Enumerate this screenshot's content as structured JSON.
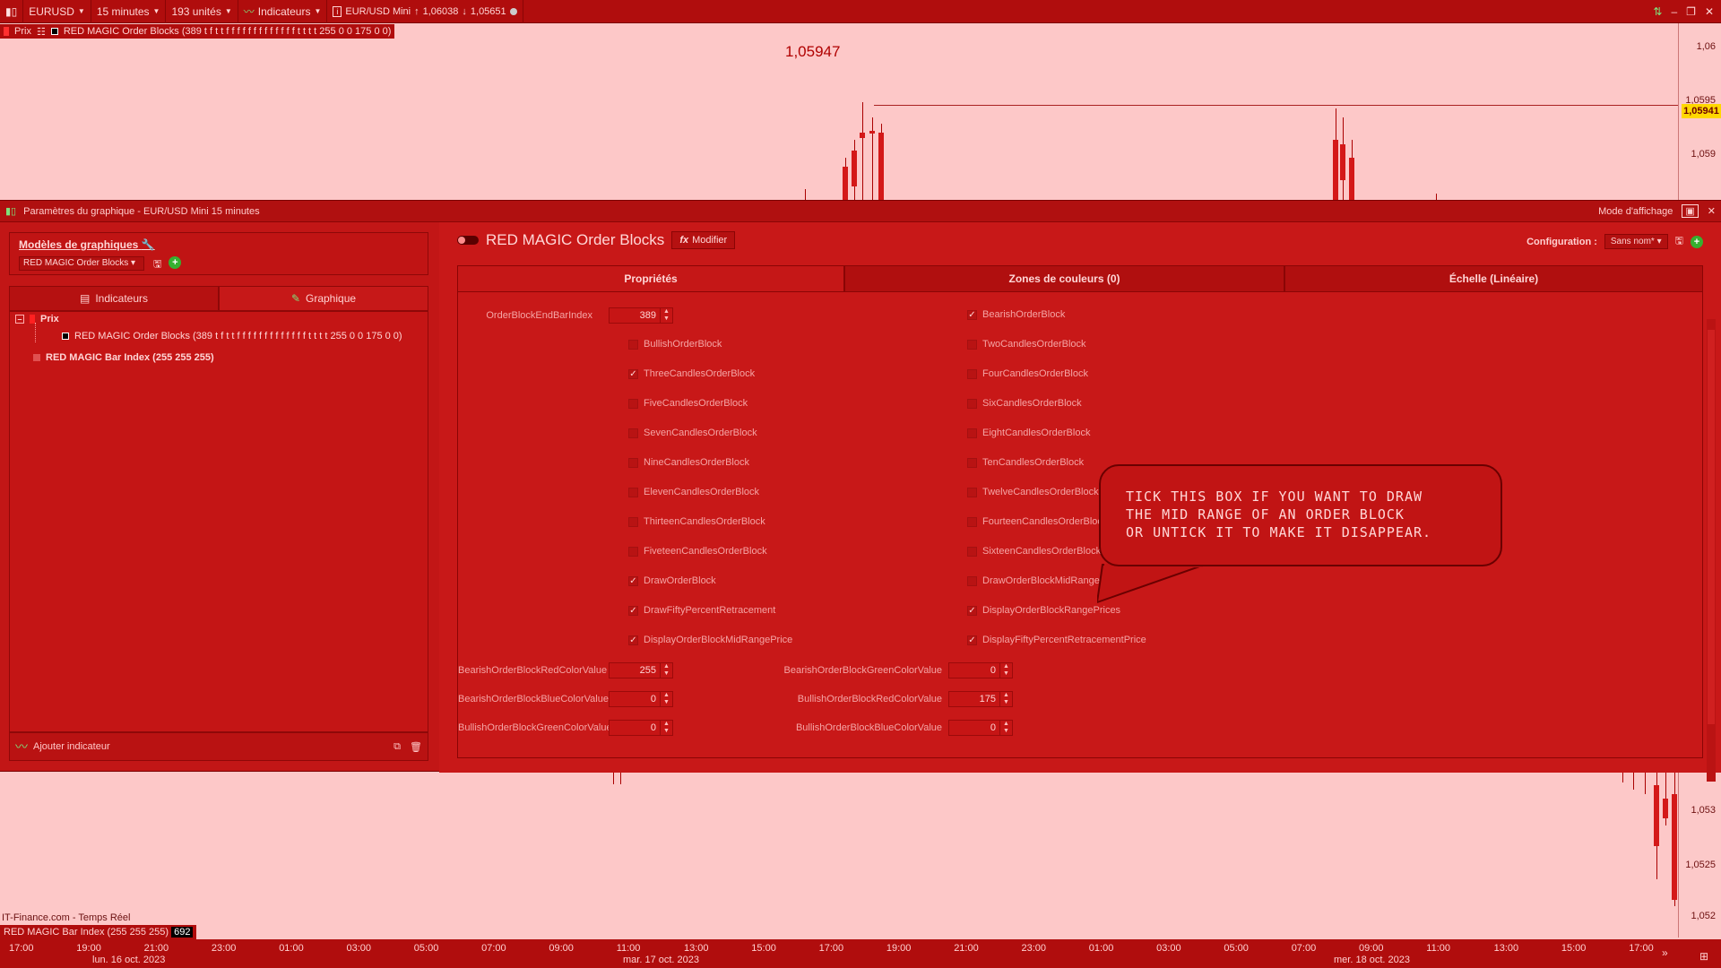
{
  "toolbar": {
    "symbol": "EURUSD",
    "timeframe": "15 minutes",
    "units": "193 unités",
    "indicators": "Indicateurs",
    "instrument": "EUR/USD Mini",
    "up_price": "1,06038",
    "down_price": "1,05651"
  },
  "chart": {
    "legend_prefix": "Prix",
    "legend_text": "RED MAGIC Order Blocks (389 t f t t f f f f f f f f f f f f f t t t t 255 0 0 175 0 0)",
    "price_label": "1,05947",
    "y_ticks": [
      "1,06",
      "1,0595",
      "1,059",
      "1,053",
      "1,0525",
      "1,052"
    ],
    "current_price_tag": "1,05941",
    "source_text": "IT-Finance.com - Temps Réel",
    "bottom_legend_text": "RED MAGIC Bar Index (255 255 255)",
    "bottom_legend_value": "692",
    "x_ticks": [
      "17:00",
      "19:00",
      "21:00",
      "23:00",
      "01:00",
      "03:00",
      "05:00",
      "07:00",
      "09:00",
      "11:00",
      "13:00",
      "15:00",
      "17:00",
      "19:00",
      "21:00",
      "23:00",
      "01:00",
      "03:00",
      "05:00",
      "07:00",
      "09:00",
      "11:00",
      "13:00",
      "15:00",
      "17:00"
    ],
    "x_dates": [
      "lun. 16 oct. 2023",
      "mar. 17 oct. 2023",
      "mer. 18 oct. 2023"
    ]
  },
  "dialog": {
    "title": "Paramètres du graphique - EUR/USD Mini 15 minutes",
    "display_mode": "Mode d'affichage",
    "models_title": "Modèles de graphiques",
    "models_select": "RED MAGIC Order Blocks",
    "tab_indicators": "Indicateurs",
    "tab_chart": "Graphique",
    "tree_price": "Prix",
    "tree_order_blocks": "RED MAGIC Order Blocks (389 t f t t f f f f f f f f f f f f f t t t t 255 0 0 175 0 0)",
    "tree_bar_index": "RED MAGIC Bar Index (255 255 255)",
    "add_indicator": "Ajouter indicateur",
    "indicator_name": "RED MAGIC Order Blocks",
    "modify": "Modifier",
    "config_label": "Configuration :",
    "config_value": "Sans nom*",
    "tabs": [
      "Propriétés",
      "Zones de couleurs (0)",
      "Échelle (Linéaire)"
    ]
  },
  "props": {
    "order_block_end_bar_index": {
      "label": "OrderBlockEndBarIndex",
      "value": "389"
    },
    "left_checks": [
      {
        "label": "BullishOrderBlock",
        "checked": false
      },
      {
        "label": "ThreeCandlesOrderBlock",
        "checked": true
      },
      {
        "label": "FiveCandlesOrderBlock",
        "checked": false
      },
      {
        "label": "SevenCandlesOrderBlock",
        "checked": false
      },
      {
        "label": "NineCandlesOrderBlock",
        "checked": false
      },
      {
        "label": "ElevenCandlesOrderBlock",
        "checked": false
      },
      {
        "label": "ThirteenCandlesOrderBlock",
        "checked": false
      },
      {
        "label": "FiveteenCandlesOrderBlock",
        "checked": false
      },
      {
        "label": "DrawOrderBlock",
        "checked": true
      },
      {
        "label": "DrawFiftyPercentRetracement",
        "checked": true
      },
      {
        "label": "DisplayOrderBlockMidRangePrice",
        "checked": true
      }
    ],
    "right_checks": [
      {
        "label": "BearishOrderBlock",
        "checked": true
      },
      {
        "label": "TwoCandlesOrderBlock",
        "checked": false
      },
      {
        "label": "FourCandlesOrderBlock",
        "checked": false
      },
      {
        "label": "SixCandlesOrderBlock",
        "checked": false
      },
      {
        "label": "EightCandlesOrderBlock",
        "checked": false
      },
      {
        "label": "TenCandlesOrderBlock",
        "checked": false
      },
      {
        "label": "TwelveCandlesOrderBlock",
        "checked": false
      },
      {
        "label": "FourteenCandlesOrderBlock",
        "checked": false
      },
      {
        "label": "SixteenCandlesOrderBlock",
        "checked": false
      },
      {
        "label": "DrawOrderBlockMidRange",
        "checked": false
      },
      {
        "label": "DisplayOrderBlockRangePrices",
        "checked": true
      },
      {
        "label": "DisplayFiftyPercentRetracementPrice",
        "checked": true
      }
    ],
    "colors_left": [
      {
        "label": "BearishOrderBlockRedColorValue",
        "value": "255"
      },
      {
        "label": "BearishOrderBlockBlueColorValue",
        "value": "0"
      },
      {
        "label": "BullishOrderBlockGreenColorValue",
        "value": "0"
      }
    ],
    "colors_right": [
      {
        "label": "BearishOrderBlockGreenColorValue",
        "value": "0"
      },
      {
        "label": "BullishOrderBlockRedColorValue",
        "value": "175"
      },
      {
        "label": "BullishOrderBlockBlueColorValue",
        "value": "0"
      }
    ]
  },
  "callout": {
    "lines": [
      "TICK THIS BOX IF YOU WANT TO DRAW",
      "THE MID RANGE OF AN ORDER BLOCK",
      "OR UNTICK IT TO MAKE IT DISAPPEAR."
    ]
  }
}
